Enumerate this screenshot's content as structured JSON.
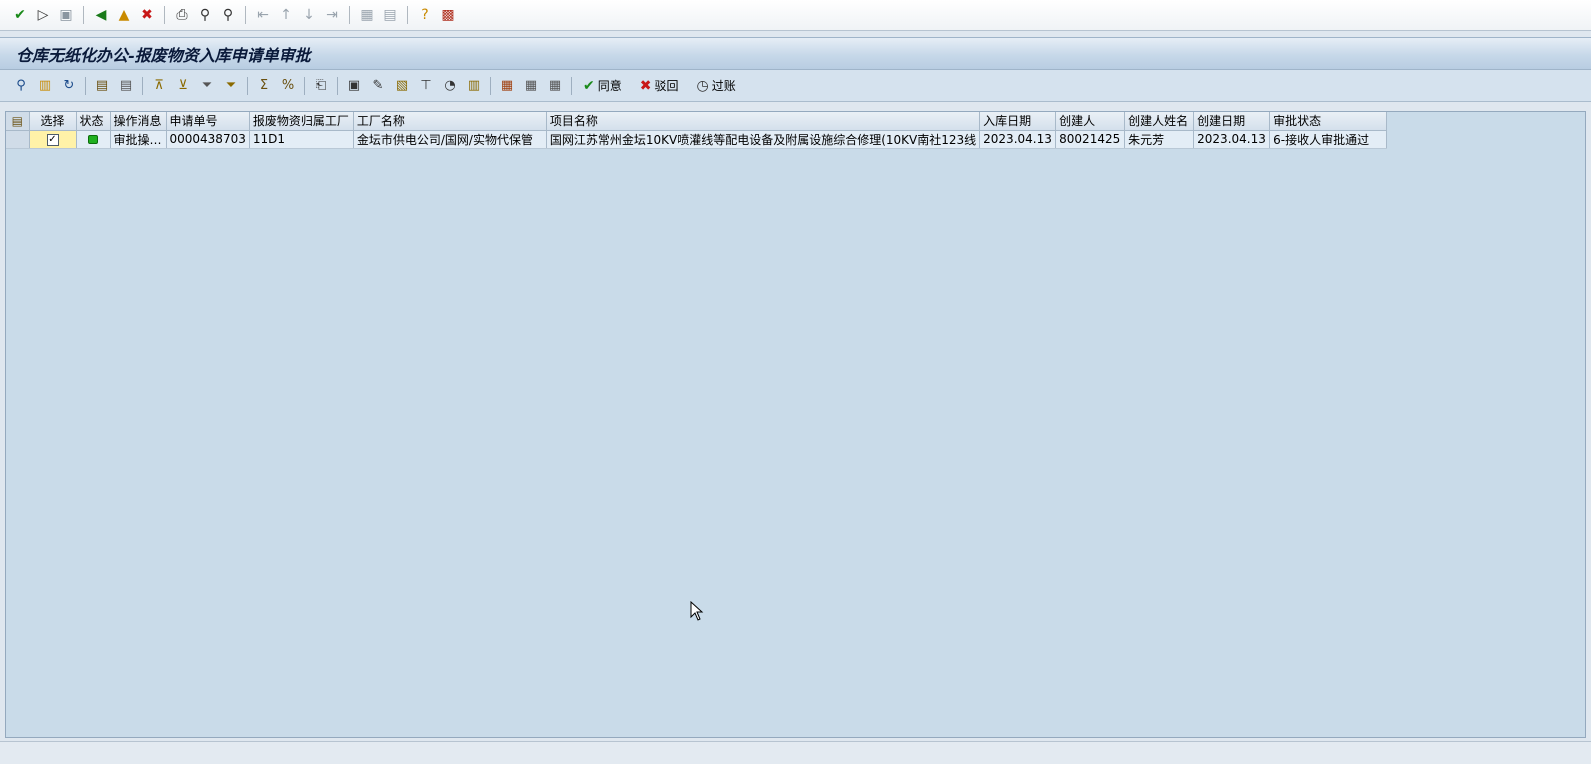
{
  "window": {
    "title": "仓库无纸化办公-报废物资入库申请单审批"
  },
  "app_toolbar": {
    "approve_label": "同意",
    "reject_label": "驳回",
    "post_label": "过账"
  },
  "grid": {
    "columns": [
      "选择",
      "状态",
      "操作消息",
      "申请单号",
      "报废物资归属工厂",
      "工厂名称",
      "项目名称",
      "入库日期",
      "创建人",
      "创建人姓名",
      "创建日期",
      "审批状态"
    ],
    "rows": [
      {
        "selected": "✓",
        "status_color": "#20b020",
        "message": "审批操…",
        "request_no": "0000438703",
        "plant": "11D1",
        "plant_name": "金坛市供电公司/国网/实物代保管",
        "project_name": "国网江苏常州金坛10KV喷灌线等配电设备及附属设施综合修理(10KV南社123线",
        "stock_date": "2023.04.13",
        "creator": "80021425",
        "creator_name": "朱元芳",
        "created_date": "2023.04.13",
        "approval_status": "6-接收人审批通过"
      }
    ]
  },
  "colors": {
    "title_bar": "#c7d8e9",
    "grid_background": "#c9dbe9",
    "status_green": "#20b020"
  }
}
